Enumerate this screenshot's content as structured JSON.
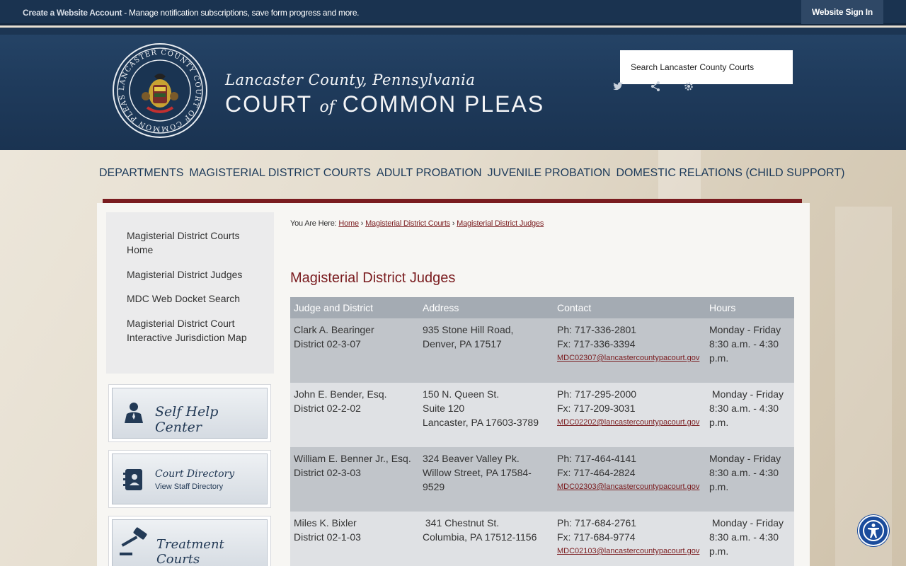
{
  "topbar": {
    "create_account": "Create a Website Account",
    "message": " - Manage notification subscriptions, save form progress and more.",
    "signin": "Website Sign In"
  },
  "header": {
    "line1": "Lancaster County, Pennsylvania",
    "line2_a": "COURT",
    "line2_of": "of",
    "line2_b": "COMMON PLEAS",
    "search_placeholder": "Search Lancaster County Courts",
    "seal_text": "LANCASTER COUNTY COURT OF COMMON PLEAS • 1791 •"
  },
  "nav": [
    "DEPARTMENTS",
    "MAGISTERIAL DISTRICT COURTS",
    "ADULT PROBATION",
    "JUVENILE PROBATION",
    "DOMESTIC RELATIONS (CHILD SUPPORT)"
  ],
  "sidemenu": [
    "Magisterial District Courts Home",
    "Magisterial District Judges",
    "MDC Web Docket Search",
    "Magisterial District Court Interactive Jurisdiction Map"
  ],
  "sideboxes": {
    "selfhelp": "Self Help Center",
    "directory": "Court Directory",
    "directory_sub": "View Staff Directory",
    "treatment": "Treatment Courts"
  },
  "breadcrumb": {
    "prefix": "You Are Here: ",
    "home": "Home",
    "sep": " › ",
    "level1": "Magisterial District Courts",
    "level2": "Magisterial District Judges"
  },
  "page_title": "Magisterial District Judges",
  "table": {
    "headers": [
      "Judge and District",
      "Address",
      "Contact",
      "Hours"
    ],
    "rows": [
      {
        "judge": "Clark A. Bearinger",
        "district": "District 02-3-07",
        "addr": [
          "935 Stone Hill Road,",
          "Denver, PA 17517"
        ],
        "ph": "Ph: 717-336-2801",
        "fx": "Fx: 717-336-3394",
        "email": "MDC02307@lancastercountypacourt.gov",
        "hours1": "Monday - Friday",
        "hours2": "8:30 a.m. - 4:30 p.m."
      },
      {
        "judge": "John E. Bender, Esq.",
        "district": "District 02-2-02",
        "addr": [
          "150 N. Queen St.",
          "Suite 120",
          "Lancaster, PA 17603-3789"
        ],
        "ph": "Ph: 717-295-2000",
        "fx": "Fx: 717-209-3031",
        "email": "MDC02202@lancastercountypacourt.gov",
        "hours1": " Monday - Friday",
        "hours2": "8:30 a.m. - 4:30 p.m."
      },
      {
        "judge": "William E. Benner Jr., Esq.",
        "district": "District 02-3-03",
        "addr": [
          "324 Beaver Valley Pk.",
          "Willow Street, PA 17584-9529"
        ],
        "ph": "Ph: 717-464-4141",
        "fx": "Fx: 717-464-2824",
        "email": "MDC02303@lancastercountypacourt.gov",
        "hours1": "Monday - Friday",
        "hours2": "8:30 a.m. - 4:30 p.m."
      },
      {
        "judge": "Miles K. Bixler",
        "district": "District 02-1-03",
        "addr": [
          " 341 Chestnut St.",
          "Columbia, PA 17512-1156"
        ],
        "ph": "Ph: 717-684-2761",
        "fx": "Fx: 717-684-9774",
        "email": "MDC02103@lancastercountypacourt.gov",
        "hours1": " Monday - Friday",
        "hours2": "8:30 a.m. - 4:30 p.m."
      }
    ]
  },
  "colors": {
    "navy": "#1a3350",
    "maroon": "#7a1c1f",
    "accent_blue": "#1b4c9c"
  }
}
